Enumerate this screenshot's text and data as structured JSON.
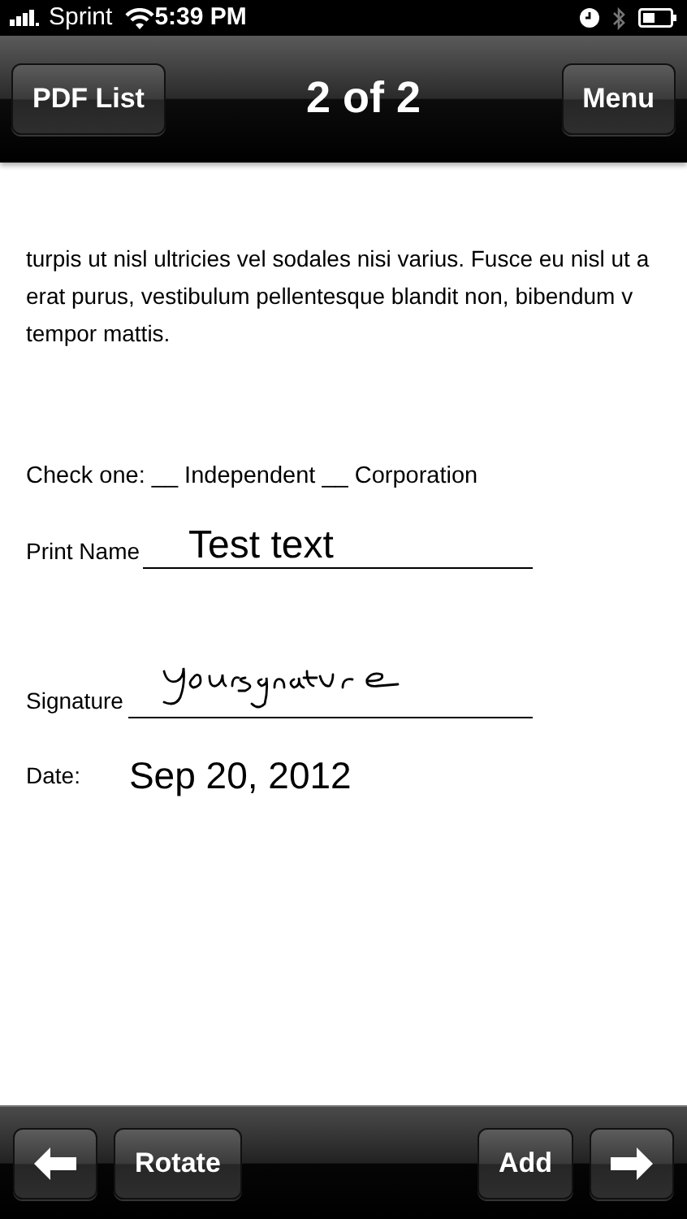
{
  "status_bar": {
    "carrier": "Sprint",
    "time": "5:39 PM"
  },
  "nav_bar": {
    "left_button": "PDF List",
    "title": "2 of 2",
    "right_button": "Menu"
  },
  "document": {
    "body_lines": [
      "turpis ut nisl ultricies vel sodales nisi varius. Fusce eu nisl ut a",
      "erat purus, vestibulum pellentesque blandit non, bibendum v",
      "tempor mattis."
    ],
    "check_line": "Check one: __ Independent __ Corporation",
    "fields": [
      {
        "kind": "text",
        "label": "Print Name",
        "value": "Test text"
      },
      {
        "kind": "signature",
        "label": "Signature"
      },
      {
        "kind": "date",
        "label": "Date:",
        "value": "Sep 20, 2012"
      }
    ]
  },
  "toolbar": {
    "buttons": [
      {
        "kind": "back"
      },
      {
        "kind": "text",
        "label": "Rotate"
      },
      {
        "kind": "spacer"
      },
      {
        "kind": "text",
        "label": "Add"
      },
      {
        "kind": "forward"
      }
    ]
  }
}
